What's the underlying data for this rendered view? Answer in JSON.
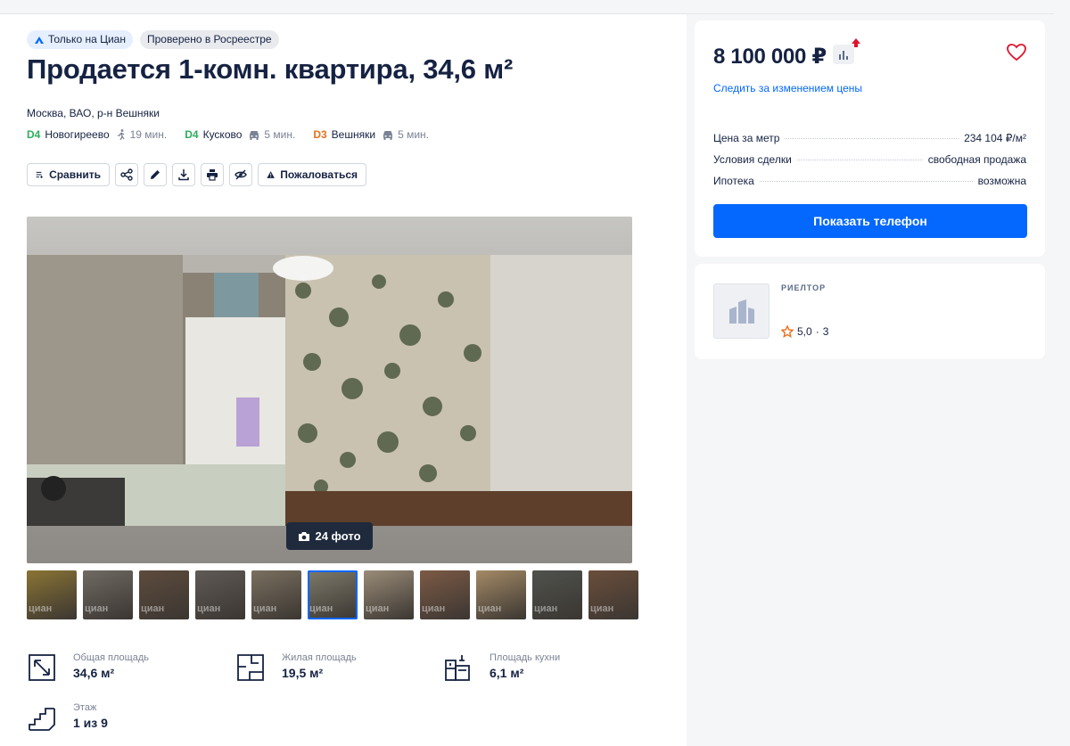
{
  "badges": {
    "cian": "Только на Циан",
    "rosreestr": "Проверено в Росреестре"
  },
  "title": "Продается 1-комн. квартира, 34,6 м²",
  "address": "Москва, ВАО, р-н Вешняки",
  "metros": [
    {
      "line": "D4",
      "name": "Новогиреево",
      "mode": "walk-icon",
      "time": "19 мин."
    },
    {
      "line": "D4",
      "name": "Кусково",
      "mode": "car-icon",
      "time": "5 мин."
    },
    {
      "line": "D3",
      "name": "Вешняки",
      "mode": "car-icon",
      "time": "5 мин."
    }
  ],
  "toolbar": {
    "compare": "Сравнить",
    "complain": "Пожаловаться"
  },
  "gallery": {
    "photo_count": "24 фото",
    "watermark": "циан",
    "thumbs_count": 11,
    "active_thumb": 6
  },
  "facts": {
    "total": {
      "label": "Общая площадь",
      "value": "34,6 м²"
    },
    "living": {
      "label": "Жилая площадь",
      "value": "19,5 м²"
    },
    "kitchen": {
      "label": "Площадь кухни",
      "value": "6,1 м²"
    },
    "floor": {
      "label": "Этаж",
      "value": "1 из 9"
    }
  },
  "price": {
    "value": "8 100 000 ₽",
    "follow": "Следить за изменением цены",
    "details": [
      {
        "label": "Цена за метр",
        "value": "234 104 ₽/м²"
      },
      {
        "label": "Условия сделки",
        "value": "свободная продажа"
      },
      {
        "label": "Ипотека",
        "value": "возможна"
      }
    ],
    "phone_button": "Показать телефон"
  },
  "realtor": {
    "label": "РИЕЛТОР",
    "rating": "5,0",
    "reviews": "3"
  },
  "colors": {
    "accent": "#0468ff",
    "d4": "#2dae5d",
    "d3": "#e9711d",
    "price_up": "#e0142e"
  }
}
